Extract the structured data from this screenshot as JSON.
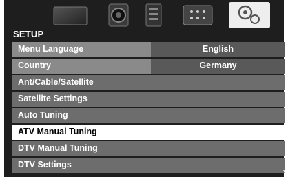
{
  "section_title": "SETUP",
  "tabs": [
    {
      "icon": "picture-icon"
    },
    {
      "icon": "sound-icon"
    },
    {
      "icon": "power-icon"
    },
    {
      "icon": "apps-icon"
    },
    {
      "icon": "settings-icon",
      "active": true
    }
  ],
  "menu": {
    "items": [
      {
        "label": "Menu Language",
        "value": "English"
      },
      {
        "label": "Country",
        "value": "Germany"
      },
      {
        "label": "Ant/Cable/Satellite"
      },
      {
        "label": "Satellite Settings"
      },
      {
        "label": "Auto Tuning"
      },
      {
        "label": "ATV Manual Tuning",
        "selected": true
      },
      {
        "label": "DTV Manual Tuning"
      },
      {
        "label": "DTV Settings"
      }
    ]
  },
  "scroll_indicator": "▼"
}
